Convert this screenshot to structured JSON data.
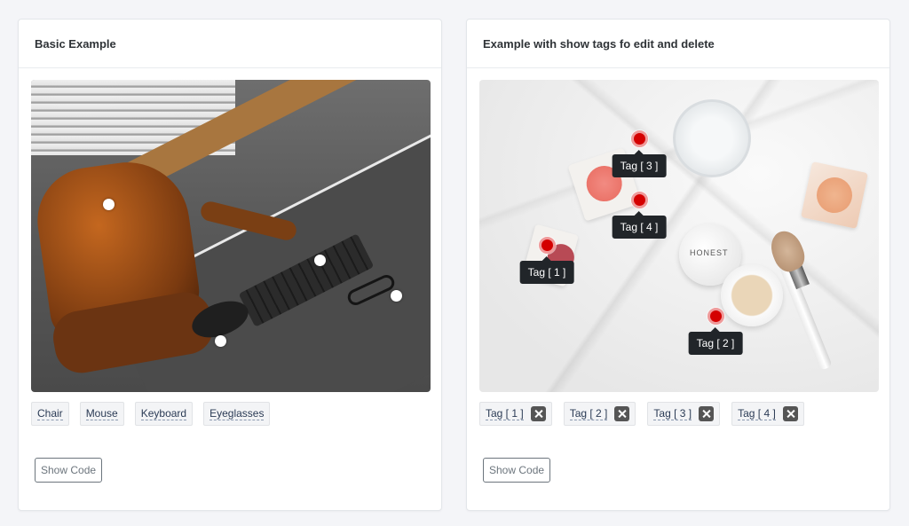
{
  "basic": {
    "title": "Basic Example",
    "tags": [
      {
        "label": "Chair"
      },
      {
        "label": "Mouse"
      },
      {
        "label": "Keyboard"
      },
      {
        "label": "Eyeglasses"
      }
    ],
    "show_code_label": "Show Code"
  },
  "editable": {
    "title": "Example with show tags fo edit and delete",
    "photo_brand_text": "HONEST",
    "tags": [
      {
        "label": "Tag [ 1 ]"
      },
      {
        "label": "Tag [ 2 ]"
      },
      {
        "label": "Tag [ 3 ]"
      },
      {
        "label": "Tag [ 4 ]"
      }
    ],
    "show_code_label": "Show Code"
  },
  "colors": {
    "tag_pin": "#d40000",
    "tooltip_bg": "#212529",
    "page_bg": "#f4f5f8"
  },
  "icons": {
    "delete": "close-icon"
  }
}
